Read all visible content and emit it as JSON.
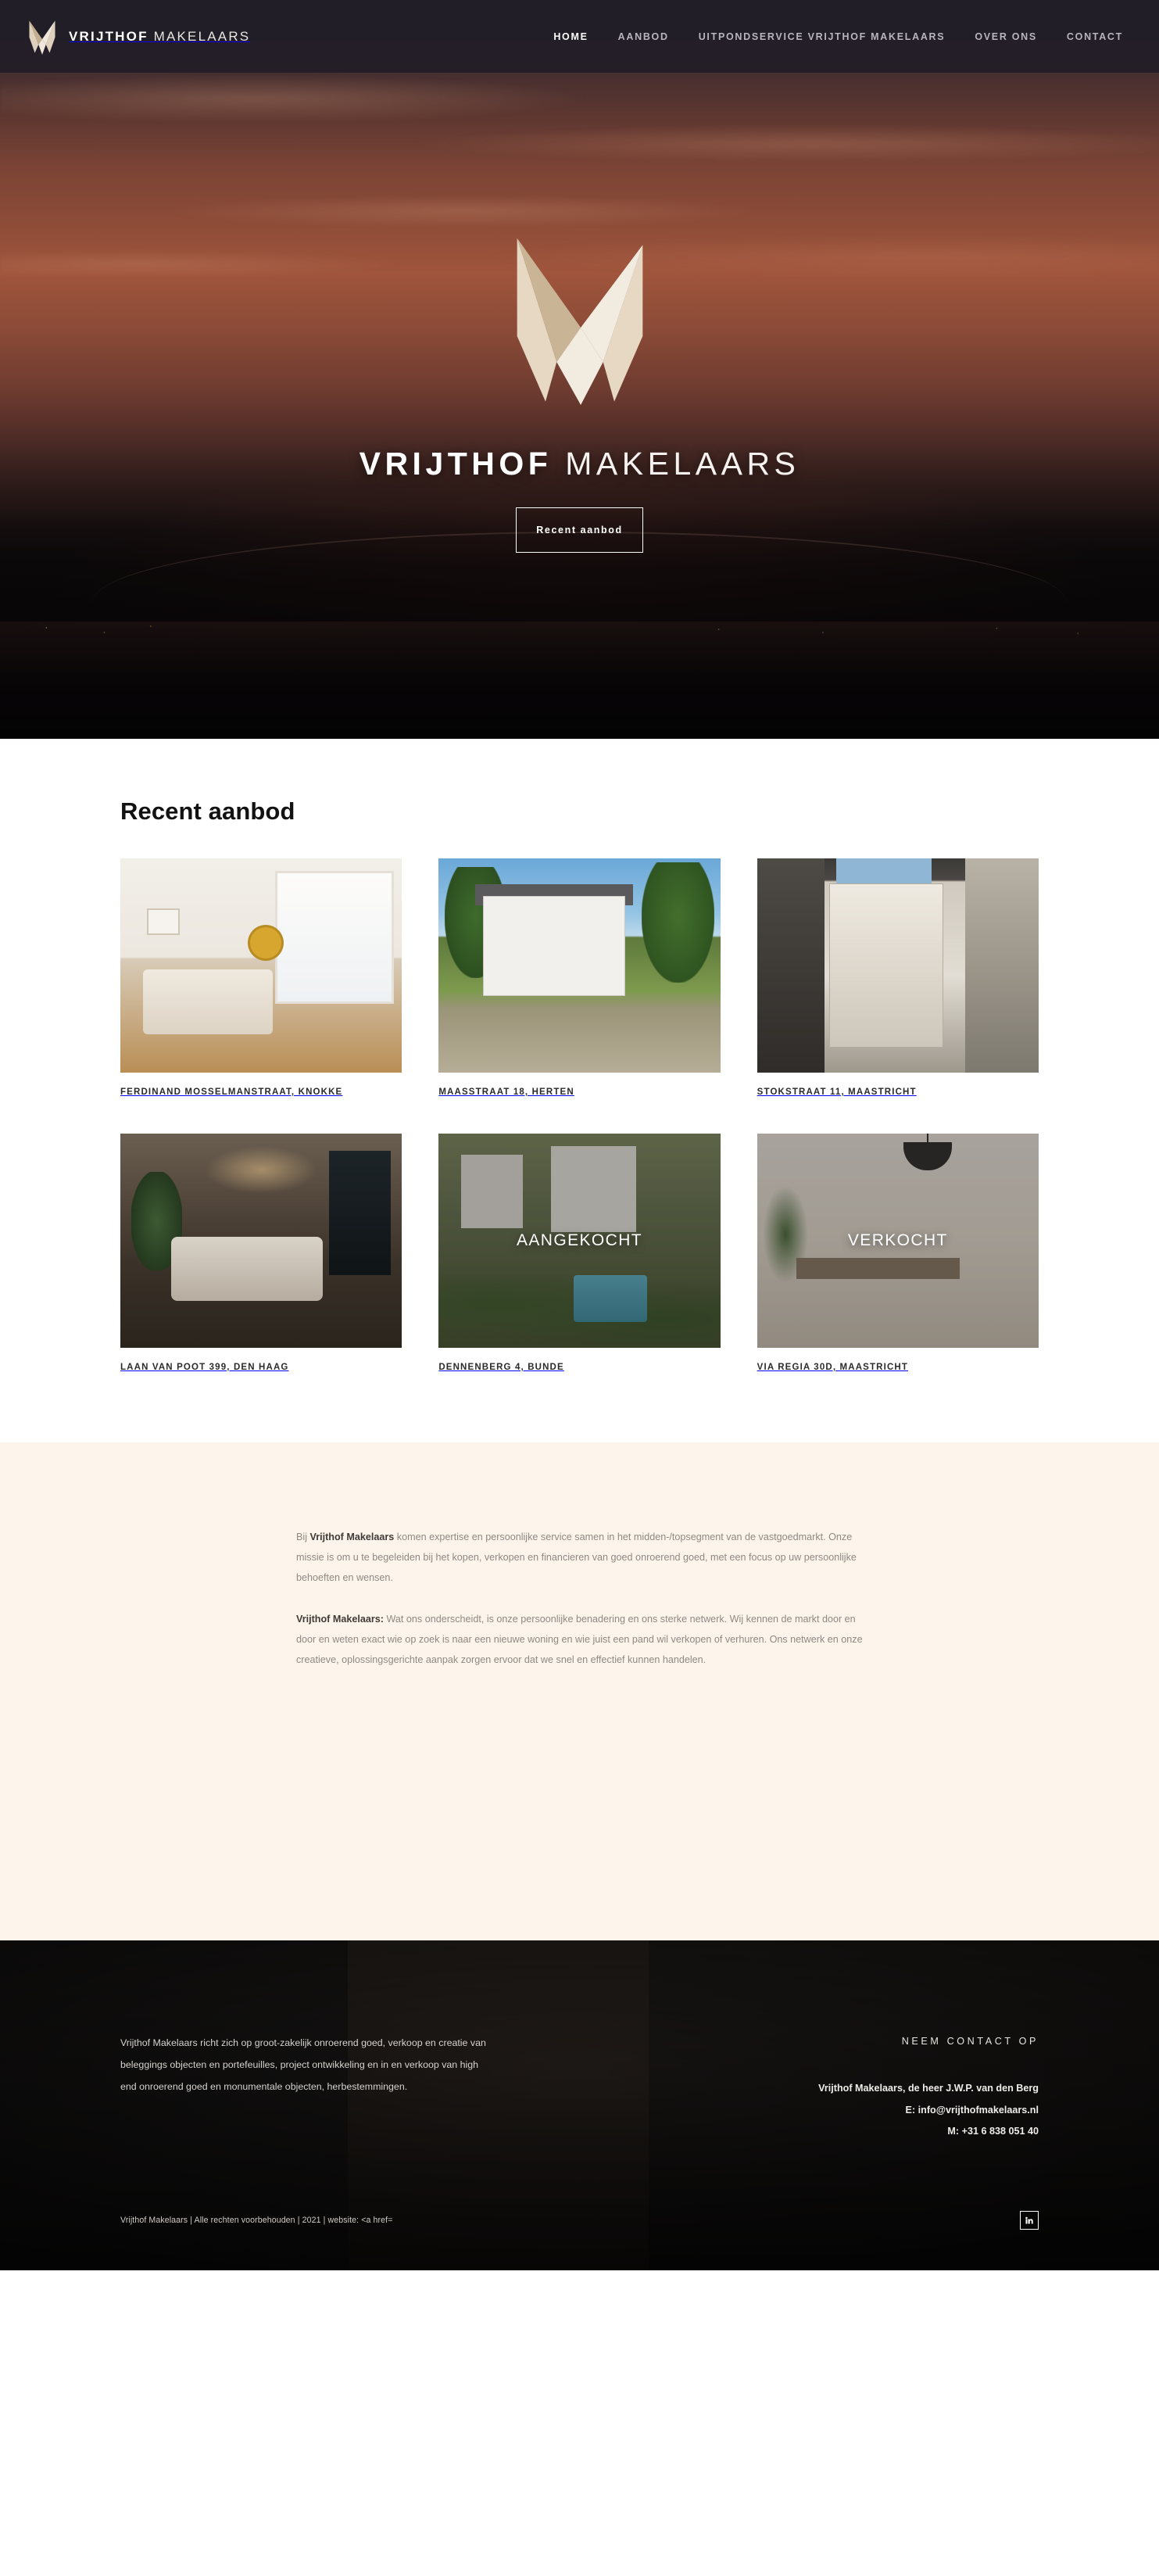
{
  "brand": {
    "name_bold": "VRIJTHOF",
    "name_light": "MAKELAARS",
    "logo_icon": "vrijthof-m-logo"
  },
  "nav": {
    "items": [
      {
        "label": "HOME",
        "active": true
      },
      {
        "label": "AANBOD",
        "active": false
      },
      {
        "label": "UITPONDSERVICE VRIJTHOF MAKELAARS",
        "active": false
      },
      {
        "label": "OVER ONS",
        "active": false
      },
      {
        "label": "CONTACT",
        "active": false
      }
    ]
  },
  "hero": {
    "title_bold": "VRIJTHOF",
    "title_light": "MAKELAARS",
    "cta_label": "Recent aanbod"
  },
  "listings": {
    "title": "Recent aanbod",
    "cards": [
      {
        "caption": "FERDINAND MOSSELMANSTRAAT, KNOKKE",
        "photo": "ph-living1",
        "badge": ""
      },
      {
        "caption": "MAASSTRAAT 18, HERTEN",
        "photo": "ph-house",
        "badge": ""
      },
      {
        "caption": "STOKSTRAAT 11, MAASTRICHT",
        "photo": "ph-street",
        "badge": ""
      },
      {
        "caption": "LAAN VAN POOT 399, DEN HAAG",
        "photo": "ph-lounge",
        "badge": ""
      },
      {
        "caption": "DENNENBERG 4, BUNDE",
        "photo": "ph-villa",
        "badge": "AANGEKOCHT"
      },
      {
        "caption": "VIA REGIA 30D, MAASTRICHT",
        "photo": "ph-dining",
        "badge": "VERKOCHT"
      }
    ]
  },
  "about": {
    "p1_lead": "Bij ",
    "p1_bold": "Vrijthof Makelaars",
    "p1_rest": " komen expertise en persoonlijke service samen in het midden-/topsegment van de vastgoedmarkt. Onze missie is om u te begeleiden bij het kopen, verkopen en financieren van goed onroerend goed, met een focus op uw persoonlijke behoeften en wensen.",
    "p2_bold": "Vrijthof Makelaars:",
    "p2_rest": " Wat ons onderscheidt, is onze persoonlijke benadering en ons sterke netwerk. Wij kennen de markt door en door en weten exact wie op zoek is naar een nieuwe woning en wie juist een pand wil verkopen of verhuren. Ons netwerk en onze creatieve, oplossingsgerichte aanpak zorgen ervoor dat we snel en effectief kunnen handelen."
  },
  "footer": {
    "description": "Vrijthof Makelaars richt zich op groot-zakelijk onroerend goed, verkoop en creatie van beleggings objecten en portefeuilles, project ontwikkeling en in en verkoop van high end onroerend goed en monumentale objecten, herbestemmingen.",
    "contact_heading": "NEEM CONTACT OP",
    "contact_name": "Vrijthof Makelaars, de heer J.W.P. van den Berg",
    "contact_email": "E: info@vrijthofmakelaars.nl",
    "contact_phone": "M: +31 6 838 051 40",
    "copyright": "Vrijthof Makelaars | Alle rechten voorbehouden | 2021 | website: <a href=",
    "social_icon": "linkedin-icon"
  },
  "colors": {
    "accent_gold": "#e0cfb5",
    "cream_bg": "#fdf4ec",
    "footer_bg": "#0b0a0a",
    "nav_bg": "#201c26"
  }
}
